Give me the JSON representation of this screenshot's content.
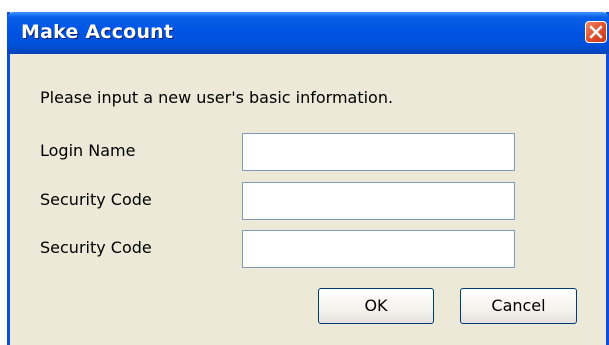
{
  "window": {
    "title": "Make Account",
    "close_icon": "close-icon",
    "accent_color": "#0054e3",
    "close_color": "#e0502c"
  },
  "form": {
    "prompt": "Please input a new user's basic information.",
    "fields": [
      {
        "label": "Login Name",
        "value": ""
      },
      {
        "label": "Security Code",
        "value": ""
      },
      {
        "label": "Security Code",
        "value": ""
      }
    ]
  },
  "buttons": {
    "ok_label": "OK",
    "cancel_label": "Cancel"
  }
}
